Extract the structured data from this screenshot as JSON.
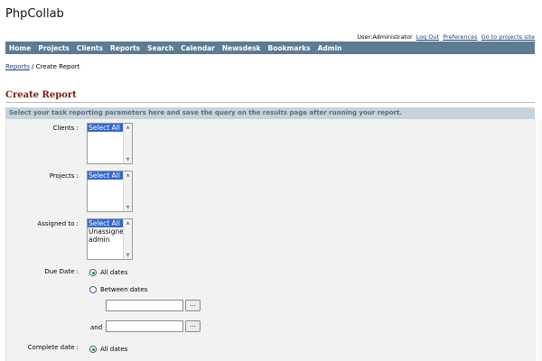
{
  "app": {
    "title": "PhpCollab"
  },
  "user_bar": {
    "user_text": "User:Administrator",
    "logout": "Log Out",
    "preferences": "Preferences",
    "goto_site": "Go to projects site"
  },
  "nav": {
    "items": [
      "Home",
      "Projects",
      "Clients",
      "Reports",
      "Search",
      "Calendar",
      "Newsdesk",
      "Bookmarks",
      "Admin"
    ]
  },
  "breadcrumb": {
    "link": "Reports",
    "separator": " / ",
    "current": "Create Report"
  },
  "section": {
    "title": "Create Report"
  },
  "instructions": "Select your task reporting parameters here and save the query on the results page after running your report.",
  "form": {
    "clients": {
      "label": "Clients :",
      "options": [
        "Select All"
      ]
    },
    "projects": {
      "label": "Projects :",
      "options": [
        "Select All"
      ]
    },
    "assigned_to": {
      "label": "Assigned to :",
      "options": [
        "Select All",
        "Unassigned",
        "admin"
      ]
    },
    "due_date": {
      "label": "Due Date :",
      "all_dates": "All dates",
      "between_dates": "Between dates",
      "and_label": "and",
      "picker_button": "..."
    },
    "complete_date": {
      "label": "Complete date :",
      "all_dates": "All dates"
    }
  }
}
